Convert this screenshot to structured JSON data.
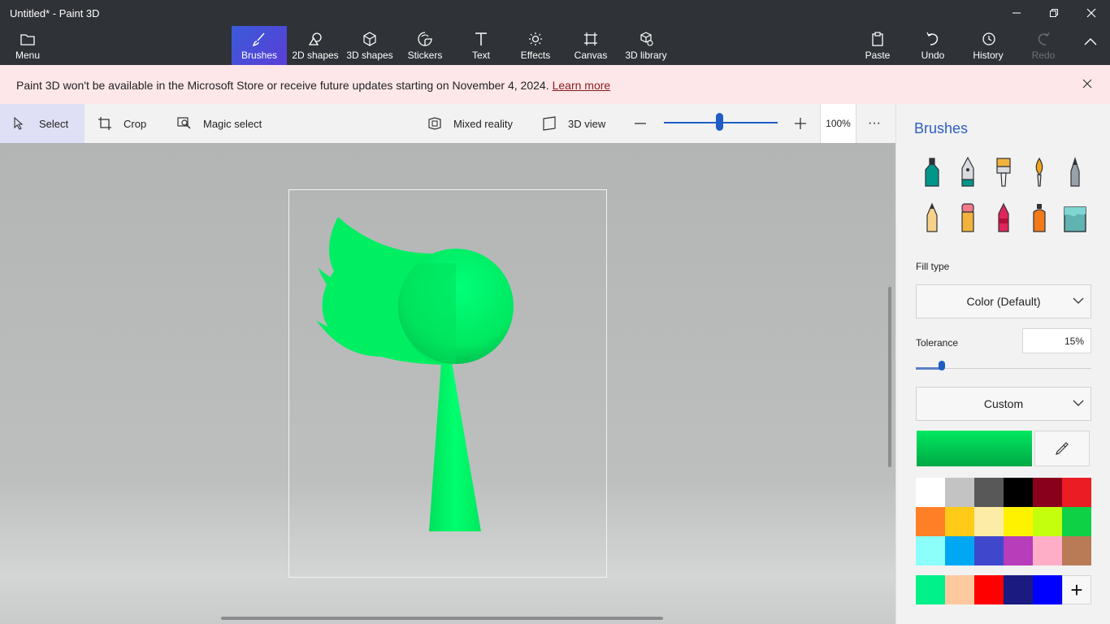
{
  "window": {
    "title": "Untitled* - Paint 3D"
  },
  "ribbon": {
    "menu": "Menu",
    "tools": [
      {
        "label": "Brushes",
        "icon": "brush-icon"
      },
      {
        "label": "2D shapes",
        "icon": "shapes-2d-icon"
      },
      {
        "label": "3D shapes",
        "icon": "cube-icon"
      },
      {
        "label": "Stickers",
        "icon": "sticker-icon"
      },
      {
        "label": "Text",
        "icon": "text-icon"
      },
      {
        "label": "Effects",
        "icon": "sun-icon"
      },
      {
        "label": "Canvas",
        "icon": "canvas-icon"
      },
      {
        "label": "3D library",
        "icon": "library-icon"
      }
    ],
    "paste": "Paste",
    "undo": "Undo",
    "history": "History",
    "redo": "Redo"
  },
  "banner": {
    "message": "Paint 3D won't be available in the Microsoft Store or receive future updates starting on November 4, 2024.",
    "link": "Learn more"
  },
  "toolbar": {
    "select": "Select",
    "crop": "Crop",
    "magic_select": "Magic select",
    "mixed_reality": "Mixed reality",
    "view_3d": "3D view",
    "zoom": "100%",
    "more": "···"
  },
  "panel": {
    "title": "Brushes",
    "fill_type_label": "Fill type",
    "fill_type_value": "Color (Default)",
    "tolerance_label": "Tolerance",
    "tolerance_value": "15%",
    "tolerance_fraction": 0.15,
    "color_mode": "Custom",
    "current_color": "#00e860",
    "palette": [
      "#ffffff",
      "#c3c3c3",
      "#585858",
      "#000000",
      "#88001b",
      "#ec1c24",
      "#ff7f27",
      "#ffca18",
      "#fdeca6",
      "#fff200",
      "#c4ff0e",
      "#0ed145",
      "#8cfffb",
      "#00a8f3",
      "#3f48cc",
      "#b83dba",
      "#ffaec8",
      "#b97a56"
    ],
    "custom_colors": [
      "#00f08a",
      "#ffc9a0",
      "#ff0000",
      "#1a1a80",
      "#0000ff"
    ]
  }
}
